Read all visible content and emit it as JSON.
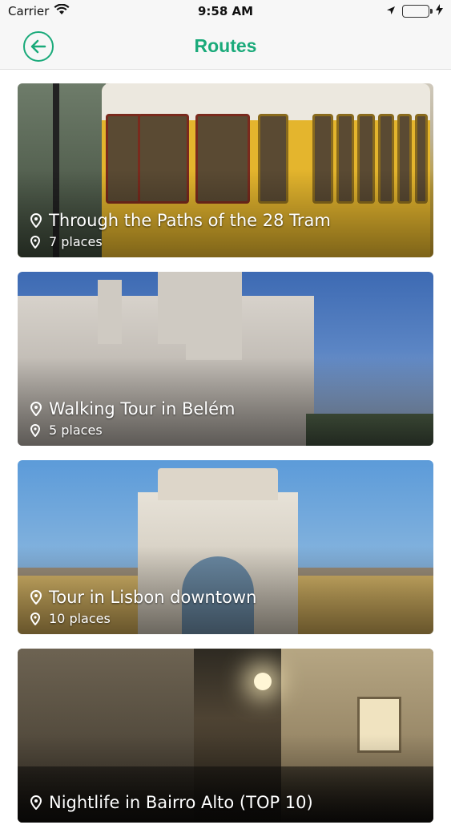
{
  "status_bar": {
    "carrier": "Carrier",
    "time": "9:58 AM"
  },
  "nav": {
    "title": "Routes",
    "back_icon": "arrow-left-circle-icon"
  },
  "colors": {
    "accent": "#1aaa7a"
  },
  "routes": [
    {
      "title": "Through the Paths of the 28 Tram",
      "places": "7 places"
    },
    {
      "title": "Walking Tour in Belém",
      "places": "5 places"
    },
    {
      "title": "Tour in Lisbon downtown",
      "places": "10 places"
    },
    {
      "title": "Nightlife in Bairro Alto (TOP 10)",
      "places": ""
    }
  ]
}
